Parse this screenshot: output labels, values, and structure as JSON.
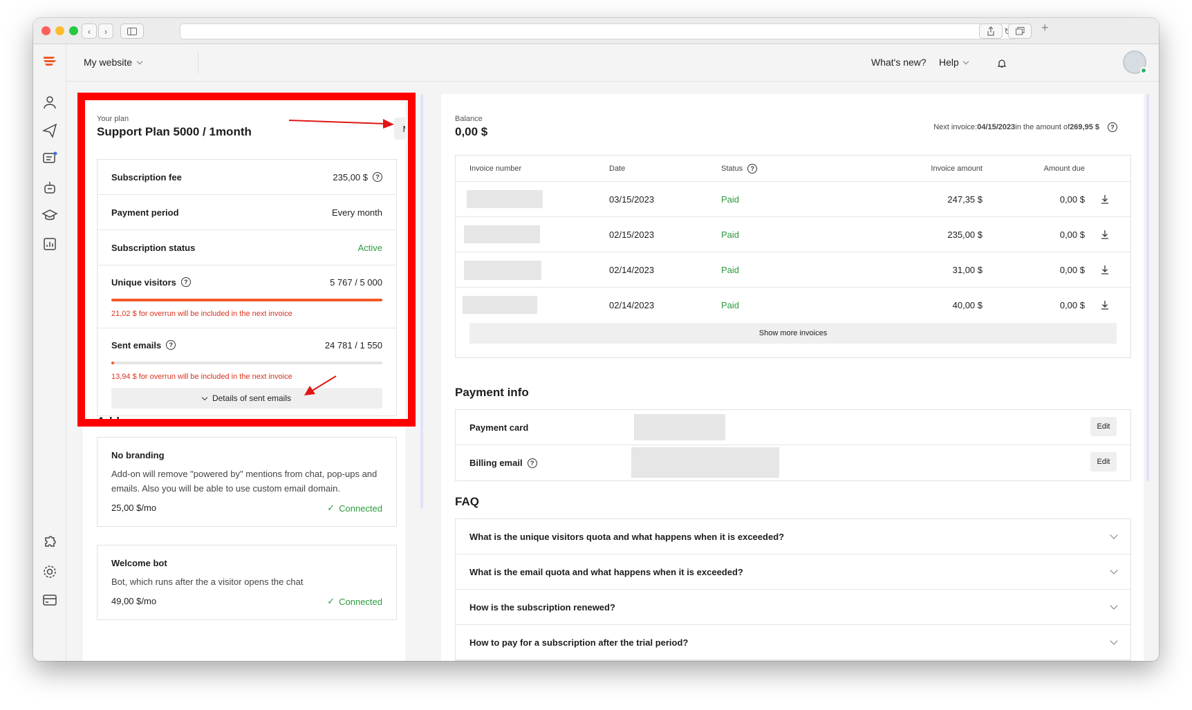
{
  "browser": {
    "url": ""
  },
  "topbar": {
    "site_label": "My website",
    "whats_new": "What's new?",
    "help": "Help"
  },
  "plan": {
    "label": "Your plan",
    "name": "Support Plan 5000 / 1month",
    "manage": "Manage",
    "rows": {
      "fee_key": "Subscription fee",
      "fee_val": "235,00 $",
      "period_key": "Payment period",
      "period_val": "Every month",
      "status_key": "Subscription status",
      "status_val": "Active"
    },
    "visitors": {
      "label": "Unique visitors",
      "value": "5 767 / 5 000",
      "fill": 1.0,
      "note": "21,02 $ for overrun will be included in the next invoice"
    },
    "emails": {
      "label": "Sent emails",
      "value": "24 781 / 1 550",
      "fill": 0.01,
      "note": "13,94 $ for overrun will be included in the next invoice",
      "details": "Details of sent emails"
    }
  },
  "addons": {
    "title": "Add-ons",
    "items": [
      {
        "name": "No branding",
        "desc": "Add-on will remove \"powered by\" mentions from chat, pop-ups and emails. Also you will be able to use custom email domain.",
        "price": "25,00 $/mo",
        "status": "Connected"
      },
      {
        "name": "Welcome bot",
        "desc": "Bot, which runs after the a visitor opens the chat",
        "price": "49,00 $/mo",
        "status": "Connected"
      }
    ]
  },
  "balance": {
    "label": "Balance",
    "amount": "0,00 $",
    "next_prefix": "Next invoice: ",
    "next_date": "04/15/2023",
    "next_mid": " in the amount of ",
    "next_amount": "269,95 $"
  },
  "invoices": {
    "headers": {
      "number": "Invoice number",
      "date": "Date",
      "status": "Status",
      "amount": "Invoice amount",
      "due": "Amount due"
    },
    "rows": [
      {
        "date": "03/15/2023",
        "status": "Paid",
        "amount": "247,35 $",
        "due": "0,00 $"
      },
      {
        "date": "02/15/2023",
        "status": "Paid",
        "amount": "235,00 $",
        "due": "0,00 $"
      },
      {
        "date": "02/14/2023",
        "status": "Paid",
        "amount": "31,00 $",
        "due": "0,00 $"
      },
      {
        "date": "02/14/2023",
        "status": "Paid",
        "amount": "40,00 $",
        "due": "0,00 $"
      }
    ],
    "show_more": "Show more invoices"
  },
  "payment_info": {
    "title": "Payment info",
    "card_label": "Payment card",
    "email_label": "Billing email",
    "edit": "Edit"
  },
  "faq": {
    "title": "FAQ",
    "items": [
      "What is the unique visitors quota and what happens when it is exceeded?",
      "What is the email quota and what happens when it is exceeded?",
      "How is the subscription renewed?",
      "How to pay for a subscription after the trial period?"
    ]
  },
  "colors": {
    "accent": "#f05a28",
    "success": "#2b9a3c",
    "danger": "#d7321f",
    "annotation": "#ff0000"
  }
}
